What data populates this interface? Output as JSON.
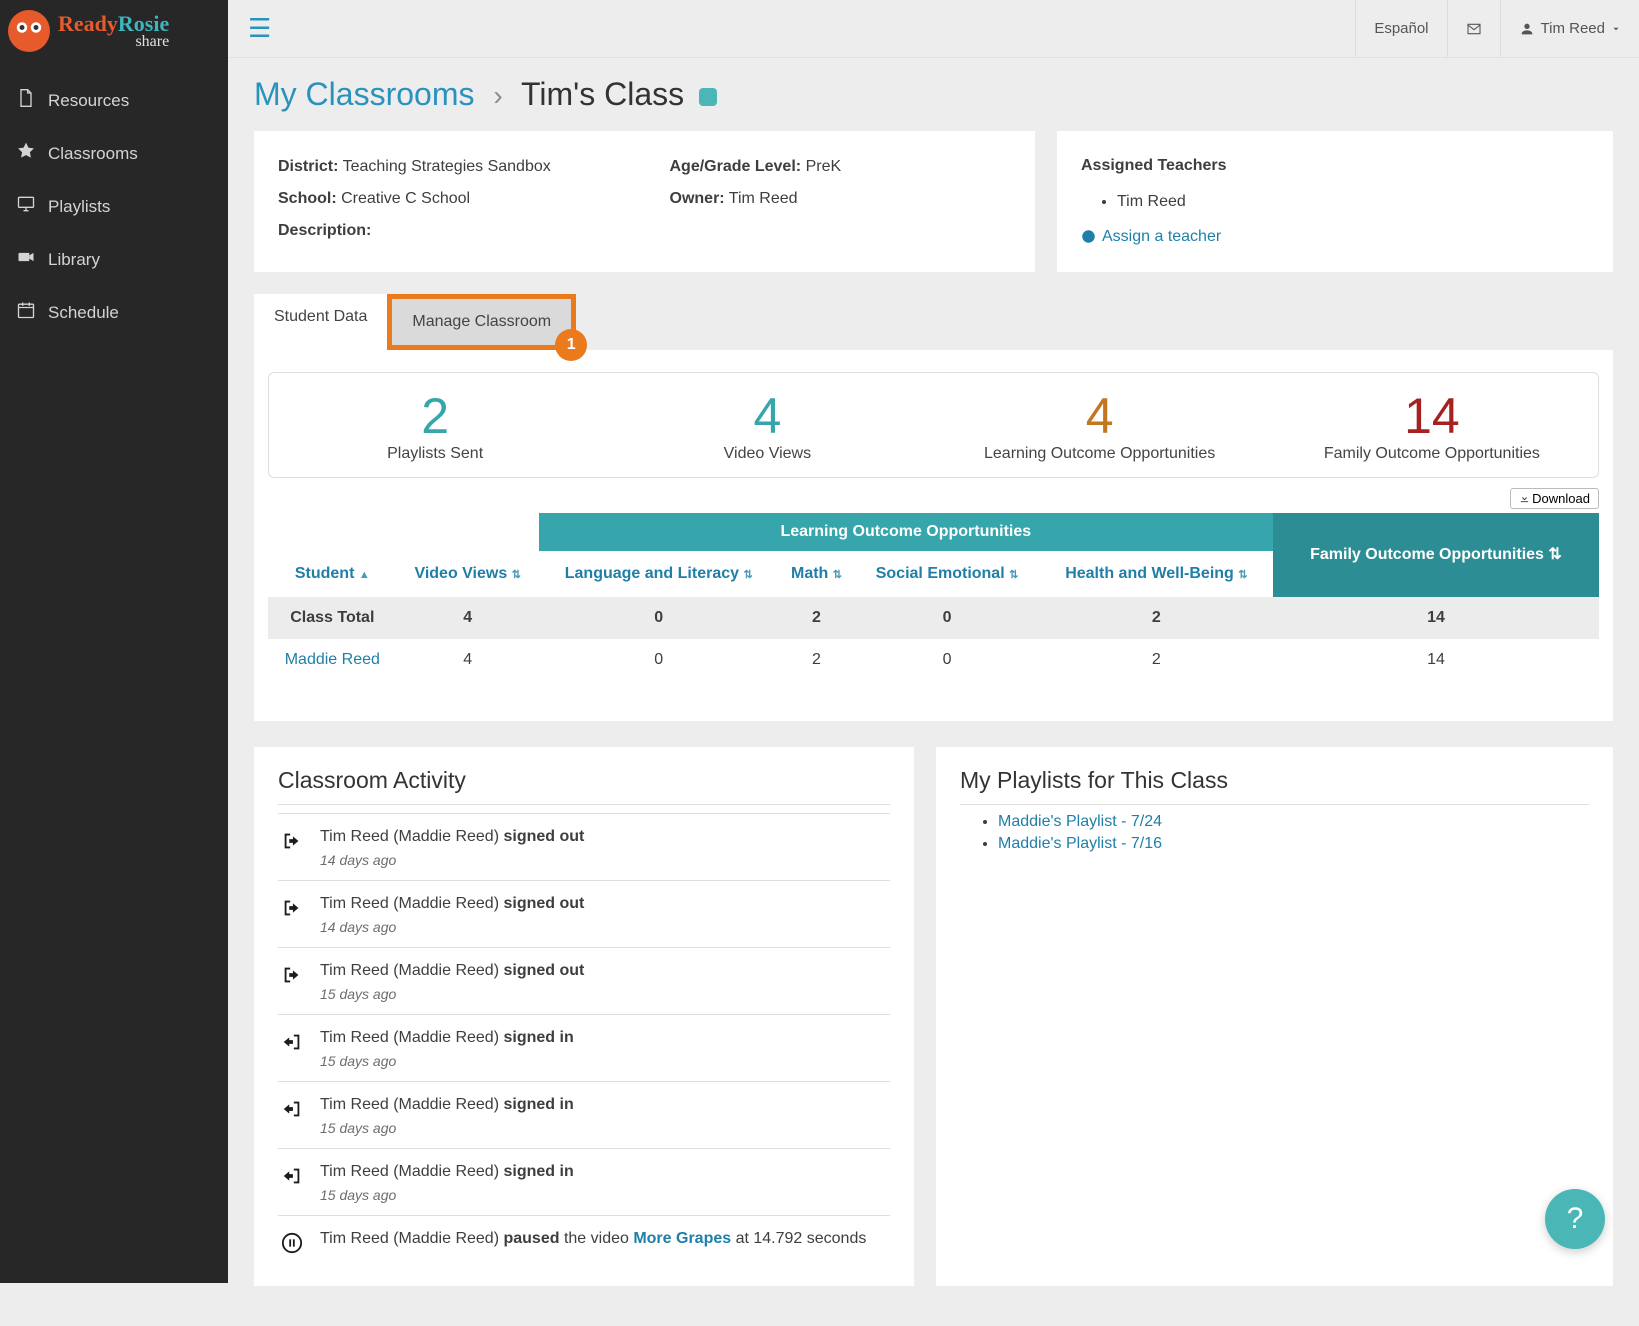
{
  "brand": {
    "name1": "Ready",
    "name2": "Rosie",
    "sub": "share"
  },
  "sidebar": {
    "items": [
      {
        "label": "Resources",
        "icon": "file"
      },
      {
        "label": "Classrooms",
        "icon": "star"
      },
      {
        "label": "Playlists",
        "icon": "monitor"
      },
      {
        "label": "Library",
        "icon": "camera"
      },
      {
        "label": "Schedule",
        "icon": "calendar"
      }
    ]
  },
  "topbar": {
    "lang": "Español",
    "user": "Tim Reed"
  },
  "breadcrumb": {
    "root": "My Classrooms",
    "current": "Tim's Class",
    "sep": "›"
  },
  "info": {
    "district_label": "District:",
    "district": "Teaching Strategies Sandbox",
    "school_label": "School:",
    "school": "Creative C School",
    "description_label": "Description:",
    "description": "",
    "grade_label": "Age/Grade Level:",
    "grade": "PreK",
    "owner_label": "Owner:",
    "owner": "Tim Reed"
  },
  "teachers": {
    "heading": "Assigned Teachers",
    "list": [
      "Tim Reed"
    ],
    "assign": "Assign a teacher"
  },
  "tabs": {
    "active": "Student Data",
    "highlighted": "Manage Classroom",
    "highlight_badge": "1"
  },
  "stats": [
    {
      "value": "2",
      "label": "Playlists Sent",
      "color": "c-teal"
    },
    {
      "value": "4",
      "label": "Video Views",
      "color": "c-teal"
    },
    {
      "value": "4",
      "label": "Learning Outcome Opportunities",
      "color": "c-orange"
    },
    {
      "value": "14",
      "label": "Family Outcome Opportunities",
      "color": "c-red"
    }
  ],
  "download_label": "Download",
  "table": {
    "group_headers": {
      "learning": "Learning Outcome Opportunities",
      "family": "Family Outcome Opportunities"
    },
    "columns": [
      "Student",
      "Video Views",
      "Language and Literacy",
      "Math",
      "Social Emotional",
      "Health and Well-Being"
    ],
    "total_row": {
      "label": "Class Total",
      "cells": [
        "4",
        "0",
        "2",
        "0",
        "2",
        "14"
      ]
    },
    "rows": [
      {
        "name": "Maddie Reed",
        "cells": [
          "4",
          "0",
          "2",
          "0",
          "2",
          "14"
        ]
      }
    ]
  },
  "activity": {
    "heading": "Classroom Activity",
    "items": [
      {
        "icon": "out",
        "who": "Tim Reed (Maddie Reed) ",
        "action": "signed out",
        "time": "14 days ago"
      },
      {
        "icon": "out",
        "who": "Tim Reed (Maddie Reed) ",
        "action": "signed out",
        "time": "14 days ago"
      },
      {
        "icon": "out",
        "who": "Tim Reed (Maddie Reed) ",
        "action": "signed out",
        "time": "15 days ago"
      },
      {
        "icon": "in",
        "who": "Tim Reed (Maddie Reed) ",
        "action": "signed in",
        "time": "15 days ago"
      },
      {
        "icon": "in",
        "who": "Tim Reed (Maddie Reed) ",
        "action": "signed in",
        "time": "15 days ago"
      },
      {
        "icon": "in",
        "who": "Tim Reed (Maddie Reed) ",
        "action": "signed in",
        "time": "15 days ago"
      },
      {
        "icon": "pause",
        "who": "Tim Reed (Maddie Reed) ",
        "action": "paused",
        "mid": " the video ",
        "video": "More Grapes",
        "tail": " at 14.792 seconds",
        "time": ""
      }
    ]
  },
  "playlists": {
    "heading": "My Playlists for This Class",
    "items": [
      "Maddie's Playlist - 7/24",
      "Maddie's Playlist - 7/16"
    ]
  },
  "help": "?"
}
